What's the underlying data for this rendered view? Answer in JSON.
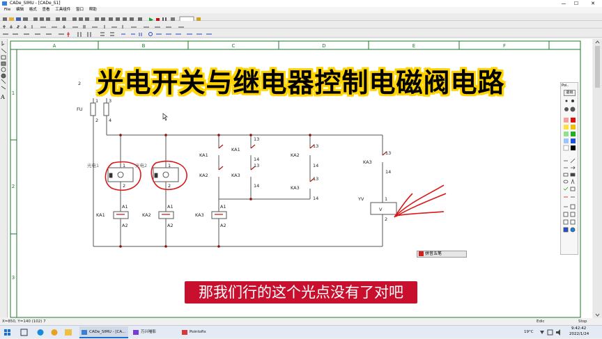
{
  "window": {
    "title": "CADe_SIMU - [CADe_S1]",
    "minimize": "—",
    "maximize": "☐",
    "close": "✕"
  },
  "menu": [
    "File",
    "编辑",
    "格式",
    "查看",
    "工具组件",
    "窗口",
    "帮助"
  ],
  "grid": {
    "columns": [
      "A",
      "B",
      "C",
      "D",
      "E",
      "F"
    ],
    "rows": [
      "1",
      "2",
      "3"
    ]
  },
  "overlay": {
    "title": "光电开关与继电器控制电磁阀电路",
    "subtitle": "那我们行的这个光点没有了对吧"
  },
  "circuit": {
    "supply_label": "FU",
    "supply_l": "2",
    "terminals": [
      "1",
      "3",
      "2",
      "4"
    ],
    "photo1": "光电1",
    "photo2": "光电2",
    "photo_pins": [
      "1",
      "2",
      "1",
      "2"
    ],
    "relays": [
      "KA1",
      "KA2",
      "KA3"
    ],
    "coil_pins": [
      "A1",
      "A2"
    ],
    "contacts": {
      "c1": [
        "KA1",
        "KA2"
      ],
      "c2": [
        "KA1",
        "KA3"
      ],
      "c2_pins": [
        "13",
        "14",
        "13",
        "14"
      ],
      "c3": [
        "KA2",
        "KA3"
      ],
      "c3_pins": [
        "13",
        "14",
        "13",
        "14"
      ],
      "c4": "KA3",
      "c4_pins": [
        "13",
        "14"
      ]
    },
    "valve_label": "YV",
    "valve_box": "V",
    "valve_pins": [
      "1",
      "2"
    ]
  },
  "ime_bar": "拼音五笔",
  "status": {
    "coords": "X=850, Y=140 (102) 7",
    "mode": "Edic",
    "state": "Stop"
  },
  "taskbar": {
    "app1": "CADe_SIMU - [CA...",
    "app2": "万兴喵影",
    "app3": "Pointofix",
    "weather": "19°C",
    "time": "9:42:42",
    "date": "2022/1/24"
  },
  "palette": {
    "title": "Poi..",
    "mode_label": "退出"
  },
  "colors": {
    "title_text": "#000000",
    "title_outline": "#ffd400",
    "subtitle_bg": "#c8102e",
    "annotation_red": "#d81818",
    "wire": "#555555"
  }
}
